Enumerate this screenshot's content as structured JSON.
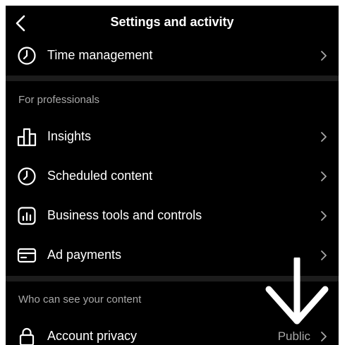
{
  "header": {
    "title": "Settings and activity",
    "back_icon": "chevron-left-icon"
  },
  "items": {
    "time_management": {
      "label": "Time management",
      "icon": "clock-icon"
    },
    "insights": {
      "label": "Insights",
      "icon": "bar-chart-icon"
    },
    "scheduled_content": {
      "label": "Scheduled content",
      "icon": "clock-icon"
    },
    "business_tools": {
      "label": "Business tools and controls",
      "icon": "business-tools-icon"
    },
    "ad_payments": {
      "label": "Ad payments",
      "icon": "card-icon"
    },
    "account_privacy": {
      "label": "Account privacy",
      "icon": "lock-icon",
      "value": "Public"
    }
  },
  "sections": {
    "professionals": {
      "title": "For professionals"
    },
    "visibility": {
      "title": "Who can see your content"
    }
  },
  "colors": {
    "background": "#000000",
    "text": "#ffffff",
    "secondary_text": "#a8a8a8",
    "divider": "#1c1c1c"
  }
}
